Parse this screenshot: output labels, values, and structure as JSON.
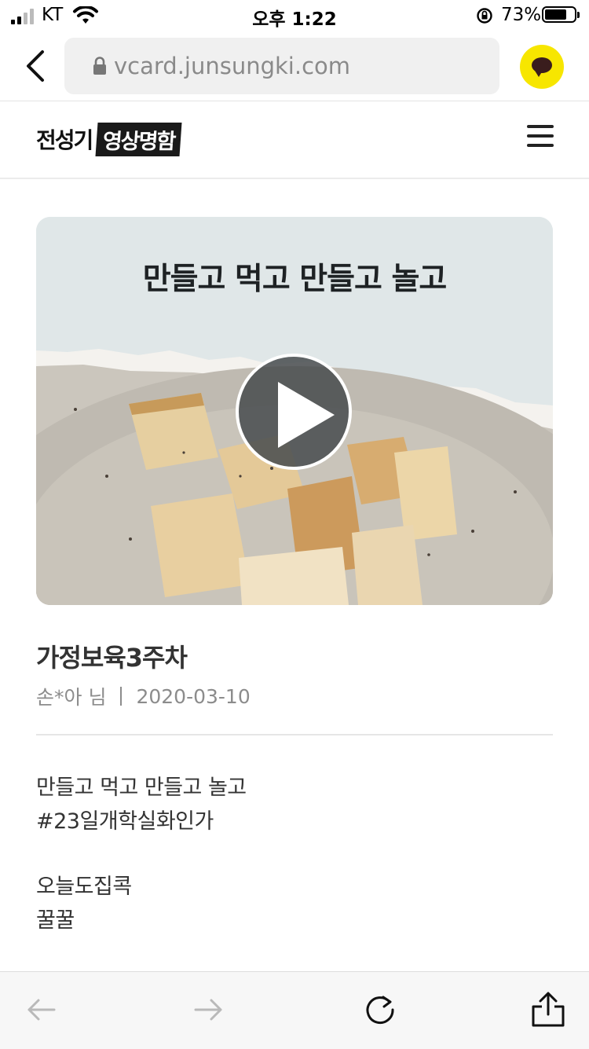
{
  "status_bar": {
    "carrier": "KT",
    "time": "오후 1:22",
    "battery_percent": "73%",
    "battery_level": 0.73
  },
  "browser": {
    "url": "vcard.junsungki.com",
    "icons": [
      "back-chevron-icon",
      "lock-icon",
      "kakaotalk-icon"
    ]
  },
  "site": {
    "logo_part1": "전성기",
    "logo_part2": "영상명함",
    "menu_icon": "hamburger-menu-icon"
  },
  "video": {
    "caption": "만들고 먹고 만들고 놀고",
    "play_icon": "play-icon"
  },
  "post": {
    "title": "가정보육3주차",
    "author": "손*아 님",
    "date": "2020-03-10",
    "body": [
      "만들고 먹고 만들고 놀고",
      "#23일개학실화인가",
      "오늘도집콕",
      "꿀꿀"
    ]
  },
  "toolbar": {
    "icons": [
      "back-arrow-icon",
      "forward-arrow-icon",
      "reload-icon",
      "share-icon"
    ]
  },
  "colors": {
    "kakao_yellow": "#f7e600",
    "kakao_brown": "#3a1d1d",
    "toolbar_bg": "#f7f7f7"
  }
}
